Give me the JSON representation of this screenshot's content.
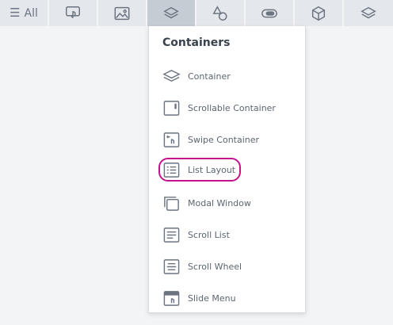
{
  "toolbar": {
    "all_label": "All",
    "buttons": [
      {
        "icon": "hamburger-icon"
      },
      {
        "icon": "touch-screen-icon"
      },
      {
        "icon": "image-icon"
      },
      {
        "icon": "layers-icon",
        "active": true
      },
      {
        "icon": "shapes-icon"
      },
      {
        "icon": "toggle-icon"
      },
      {
        "icon": "cube-icon"
      },
      {
        "icon": "stack-icon"
      }
    ]
  },
  "panel": {
    "title": "Containers",
    "items": [
      {
        "label": "Container",
        "icon": "layers-icon"
      },
      {
        "label": "Scrollable Container",
        "icon": "scrollable-container-icon"
      },
      {
        "label": "Swipe Container",
        "icon": "swipe-container-icon"
      },
      {
        "label": "List Layout",
        "icon": "list-layout-icon",
        "highlighted": true
      },
      {
        "label": "Modal Window",
        "icon": "modal-window-icon"
      },
      {
        "label": "Scroll List",
        "icon": "scroll-list-icon"
      },
      {
        "label": "Scroll Wheel",
        "icon": "scroll-wheel-icon"
      },
      {
        "label": "Slide Menu",
        "icon": "slide-menu-icon"
      }
    ],
    "highlight_color": "#c4128c"
  }
}
